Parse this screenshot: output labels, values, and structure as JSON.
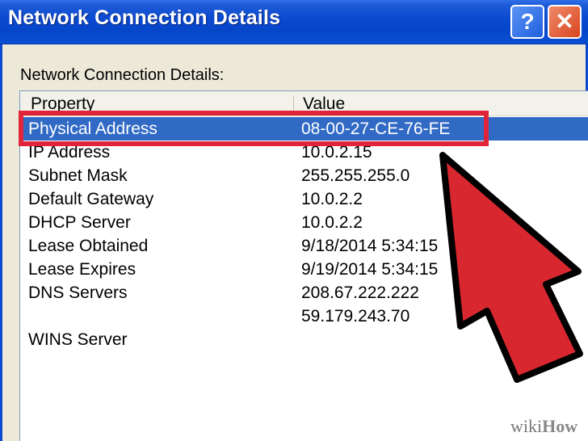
{
  "window": {
    "title": "Network Connection Details",
    "help_label": "?",
    "close_label": "✕"
  },
  "section_heading": "Network Connection Details:",
  "table": {
    "columns": [
      "Property",
      "Value"
    ],
    "selected_row_index": 0,
    "rows": [
      {
        "property": "Physical Address",
        "value": "08-00-27-CE-76-FE"
      },
      {
        "property": "IP Address",
        "value": "10.0.2.15"
      },
      {
        "property": "Subnet Mask",
        "value": "255.255.255.0"
      },
      {
        "property": "Default Gateway",
        "value": "10.0.2.2"
      },
      {
        "property": "DHCP Server",
        "value": "10.0.2.2"
      },
      {
        "property": "Lease Obtained",
        "value": "9/18/2014 5:34:15"
      },
      {
        "property": "Lease Expires",
        "value": "9/19/2014 5:34:15"
      },
      {
        "property": "DNS Servers",
        "value": "208.67.222.222"
      },
      {
        "property": "",
        "value": "59.179.243.70"
      },
      {
        "property": "WINS Server",
        "value": ""
      }
    ]
  },
  "annotation": {
    "highlight_color": "#e0253b",
    "arrow_color": "#d8272f"
  },
  "watermark": {
    "part1": "wiki",
    "part2": "How"
  },
  "colors": {
    "titlebar": "#0a49d0",
    "selection": "#316ac5",
    "close_button": "#d8451f"
  },
  "icons": {
    "help": "help-icon",
    "close": "close-icon"
  }
}
